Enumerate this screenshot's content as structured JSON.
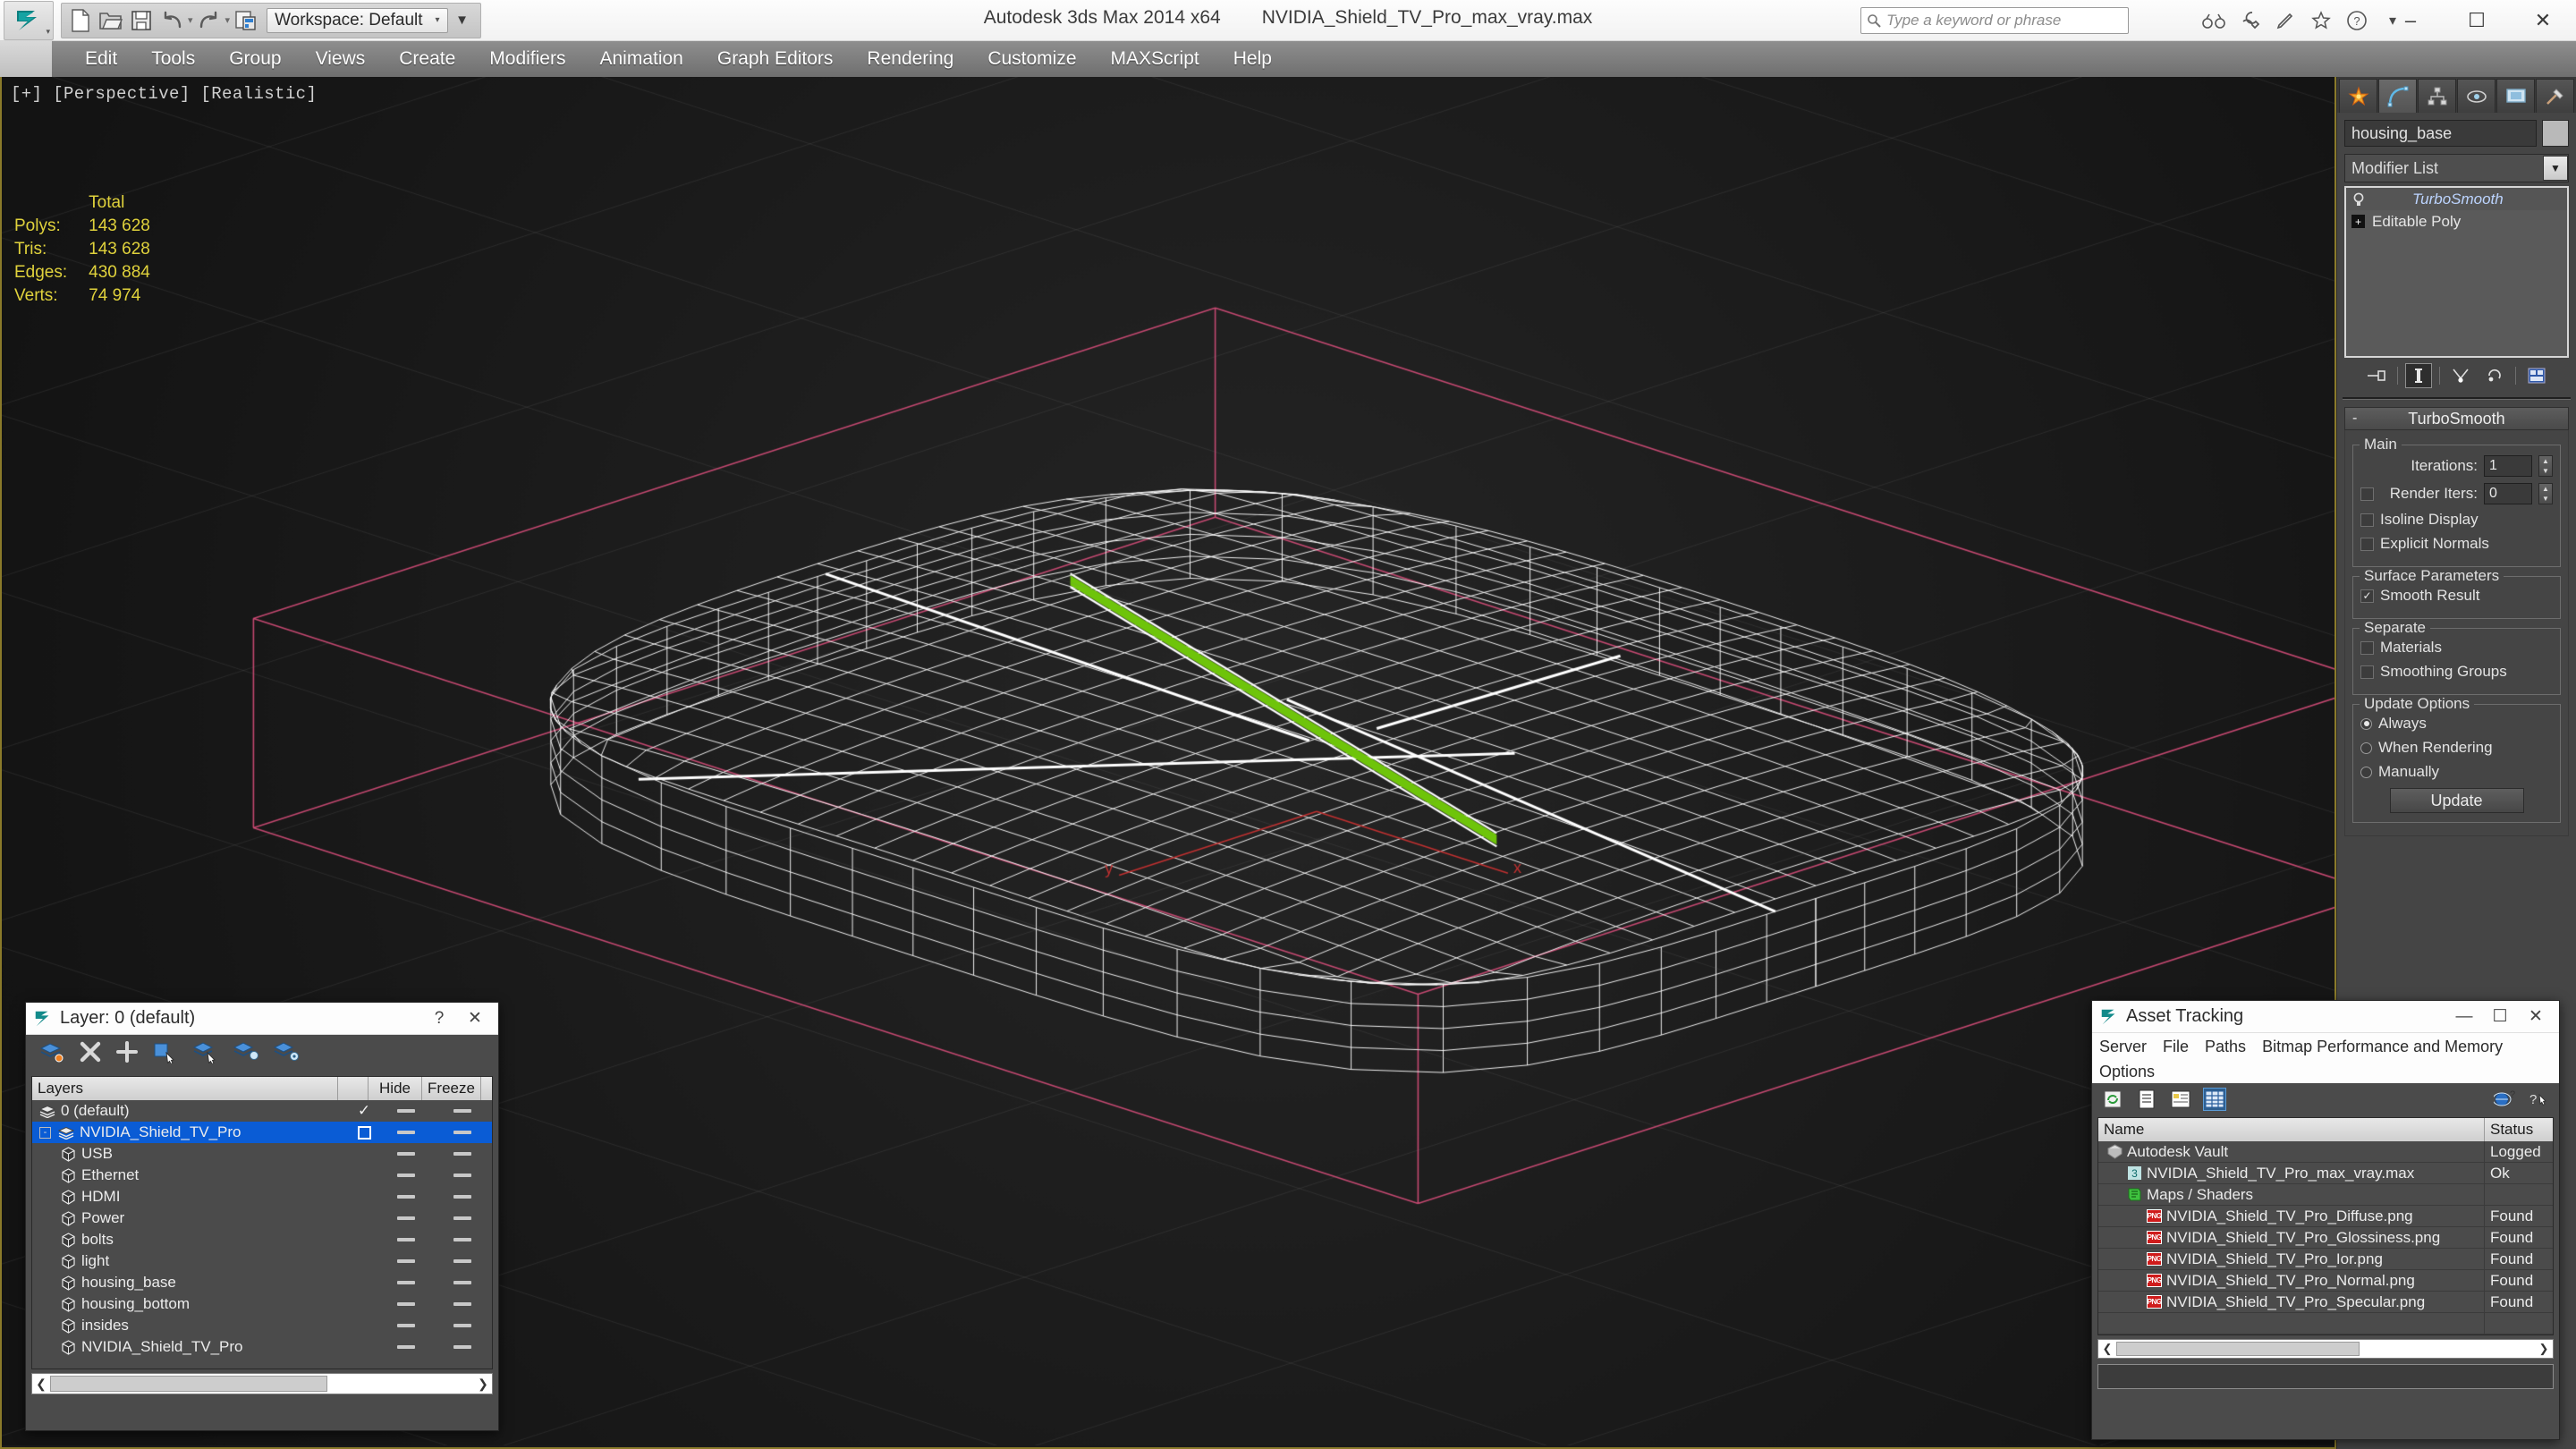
{
  "app": {
    "title": "Autodesk 3ds Max  2014 x64",
    "document": "NVIDIA_Shield_TV_Pro_max_vray.max",
    "workspace_label": "Workspace: Default",
    "search_placeholder": "Type a keyword or phrase"
  },
  "window_controls": {
    "minimize": "–",
    "maximize": "☐",
    "close": "✕"
  },
  "quick_access": [
    {
      "name": "new-file-icon",
      "label": "New"
    },
    {
      "name": "open-file-icon",
      "label": "Open"
    },
    {
      "name": "save-file-icon",
      "label": "Save"
    },
    {
      "name": "undo-icon",
      "label": "Undo"
    },
    {
      "name": "redo-icon",
      "label": "Redo"
    },
    {
      "name": "project-folder-icon",
      "label": "Set Project Folder"
    }
  ],
  "menu": {
    "items": [
      "Edit",
      "Tools",
      "Group",
      "Views",
      "Create",
      "Modifiers",
      "Animation",
      "Graph Editors",
      "Rendering",
      "Customize",
      "MAXScript",
      "Help"
    ]
  },
  "viewport": {
    "label": "[+] [Perspective] [Realistic]",
    "stats": {
      "header": "Total",
      "rows": [
        {
          "label": "Polys:",
          "value": "143 628"
        },
        {
          "label": "Tris:",
          "value": "143 628"
        },
        {
          "label": "Edges:",
          "value": "430 884"
        },
        {
          "label": "Verts:",
          "value": "74 974"
        }
      ]
    },
    "colors": {
      "background": "#1a1a1a",
      "wireframe": "#ffffff",
      "selection": "#6ec40a",
      "gizmo_pink": "#e0507f",
      "border": "#8a7a2a"
    }
  },
  "command_panel": {
    "tabs": [
      {
        "name": "create-tab",
        "glyph": "☀"
      },
      {
        "name": "modify-tab",
        "glyph": "◜"
      },
      {
        "name": "hierarchy-tab",
        "glyph": "⑂"
      },
      {
        "name": "motion-tab",
        "glyph": "◎"
      },
      {
        "name": "display-tab",
        "glyph": "▣"
      },
      {
        "name": "utilities-tab",
        "glyph": "⚒"
      }
    ],
    "active_tab_index": 1,
    "object_name": "housing_base",
    "modifier_list_label": "Modifier List",
    "stack": [
      {
        "label": "TurboSmooth",
        "selected": true
      },
      {
        "label": "Editable Poly",
        "selected": false
      }
    ],
    "rollout": {
      "title": "TurboSmooth",
      "collapse_mark": "-",
      "groups": [
        {
          "name": "Main",
          "fields": [
            {
              "type": "spinner",
              "label": "Iterations:",
              "value": "1"
            },
            {
              "type": "spinner",
              "label": "Render Iters:",
              "value": "0",
              "checkbox": false
            }
          ],
          "checks": [
            {
              "label": "Isoline Display",
              "checked": false
            },
            {
              "label": "Explicit Normals",
              "checked": false
            }
          ]
        },
        {
          "name": "Surface Parameters",
          "checks": [
            {
              "label": "Smooth Result",
              "checked": true
            }
          ]
        },
        {
          "name": "Separate",
          "checks": [
            {
              "label": "Materials",
              "checked": false
            },
            {
              "label": "Smoothing Groups",
              "checked": false
            }
          ]
        },
        {
          "name": "Update Options",
          "radios": [
            {
              "label": "Always",
              "selected": true
            },
            {
              "label": "When Rendering",
              "selected": false
            },
            {
              "label": "Manually",
              "selected": false
            }
          ],
          "button": "Update"
        }
      ]
    }
  },
  "layer_dialog": {
    "title": "Layer: 0 (default)",
    "help_button": "?",
    "close_button": "✕",
    "toolbar": [
      {
        "name": "new-layer-icon"
      },
      {
        "name": "delete-layer-icon"
      },
      {
        "name": "add-selection-icon"
      },
      {
        "name": "select-objects-icon"
      },
      {
        "name": "select-highlighted-icon"
      },
      {
        "name": "highlight-selected-icon"
      },
      {
        "name": "layer-properties-icon"
      }
    ],
    "columns": [
      "Layers",
      "",
      "Hide",
      "Freeze"
    ],
    "rows": [
      {
        "label": "0 (default)",
        "indent": 0,
        "icon": "layer-icon",
        "on": "check",
        "hide": "-",
        "freeze": "-",
        "selected": false,
        "expander": ""
      },
      {
        "label": "NVIDIA_Shield_TV_Pro",
        "indent": 0,
        "icon": "layer-icon",
        "on": "box",
        "hide": "-",
        "freeze": "-",
        "selected": true,
        "expander": "-"
      },
      {
        "label": "USB",
        "indent": 1,
        "icon": "object-icon",
        "on": "",
        "hide": "-",
        "freeze": "-",
        "selected": false,
        "expander": ""
      },
      {
        "label": "Ethernet",
        "indent": 1,
        "icon": "object-icon",
        "on": "",
        "hide": "-",
        "freeze": "-",
        "selected": false,
        "expander": ""
      },
      {
        "label": "HDMI",
        "indent": 1,
        "icon": "object-icon",
        "on": "",
        "hide": "-",
        "freeze": "-",
        "selected": false,
        "expander": ""
      },
      {
        "label": "Power",
        "indent": 1,
        "icon": "object-icon",
        "on": "",
        "hide": "-",
        "freeze": "-",
        "selected": false,
        "expander": ""
      },
      {
        "label": "bolts",
        "indent": 1,
        "icon": "object-icon",
        "on": "",
        "hide": "-",
        "freeze": "-",
        "selected": false,
        "expander": ""
      },
      {
        "label": "light",
        "indent": 1,
        "icon": "object-icon",
        "on": "",
        "hide": "-",
        "freeze": "-",
        "selected": false,
        "expander": ""
      },
      {
        "label": "housing_base",
        "indent": 1,
        "icon": "object-icon",
        "on": "",
        "hide": "-",
        "freeze": "-",
        "selected": false,
        "expander": ""
      },
      {
        "label": "housing_bottom",
        "indent": 1,
        "icon": "object-icon",
        "on": "",
        "hide": "-",
        "freeze": "-",
        "selected": false,
        "expander": ""
      },
      {
        "label": "insides",
        "indent": 1,
        "icon": "object-icon",
        "on": "",
        "hide": "-",
        "freeze": "-",
        "selected": false,
        "expander": ""
      },
      {
        "label": "NVIDIA_Shield_TV_Pro",
        "indent": 1,
        "icon": "object-icon",
        "on": "",
        "hide": "-",
        "freeze": "-",
        "selected": false,
        "expander": ""
      }
    ]
  },
  "asset_tracking": {
    "title": "Asset Tracking",
    "window_controls": {
      "minimize": "—",
      "maximize": "☐",
      "close": "✕"
    },
    "menu": [
      "Server",
      "File",
      "Paths",
      "Bitmap Performance and Memory",
      "Options"
    ],
    "toolbar": [
      {
        "name": "refresh-icon"
      },
      {
        "name": "list-view-icon"
      },
      {
        "name": "detail-view-icon"
      },
      {
        "name": "grid-view-icon",
        "active": true
      },
      {
        "name": "help-globe-icon"
      },
      {
        "name": "context-help-icon"
      }
    ],
    "columns": [
      "Name",
      "Status"
    ],
    "rows": [
      {
        "name": "Autodesk Vault",
        "status": "Logged",
        "indent": 0,
        "icon": "vault-icon"
      },
      {
        "name": "NVIDIA_Shield_TV_Pro_max_vray.max",
        "status": "Ok",
        "indent": 1,
        "icon": "max-file-icon"
      },
      {
        "name": "Maps / Shaders",
        "status": "",
        "indent": 1,
        "icon": "maps-icon"
      },
      {
        "name": "NVIDIA_Shield_TV_Pro_Diffuse.png",
        "status": "Found",
        "indent": 2,
        "icon": "png-icon"
      },
      {
        "name": "NVIDIA_Shield_TV_Pro_Glossiness.png",
        "status": "Found",
        "indent": 2,
        "icon": "png-icon"
      },
      {
        "name": "NVIDIA_Shield_TV_Pro_Ior.png",
        "status": "Found",
        "indent": 2,
        "icon": "png-icon"
      },
      {
        "name": "NVIDIA_Shield_TV_Pro_Normal.png",
        "status": "Found",
        "indent": 2,
        "icon": "png-icon"
      },
      {
        "name": "NVIDIA_Shield_TV_Pro_Specular.png",
        "status": "Found",
        "indent": 2,
        "icon": "png-icon"
      }
    ]
  }
}
